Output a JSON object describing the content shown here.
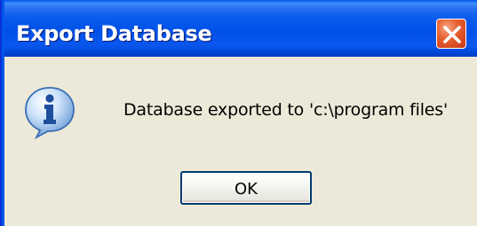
{
  "window": {
    "title": "Export Database",
    "close_icon": "close-icon"
  },
  "message": {
    "icon": "info-icon",
    "text": "Database exported to 'c:\\program files'"
  },
  "buttons": {
    "ok_label": "OK"
  },
  "colors": {
    "titlebar": "#0a5ded",
    "close_button": "#e7612f",
    "body_background": "#ece9d8",
    "button_border": "#003c74"
  }
}
